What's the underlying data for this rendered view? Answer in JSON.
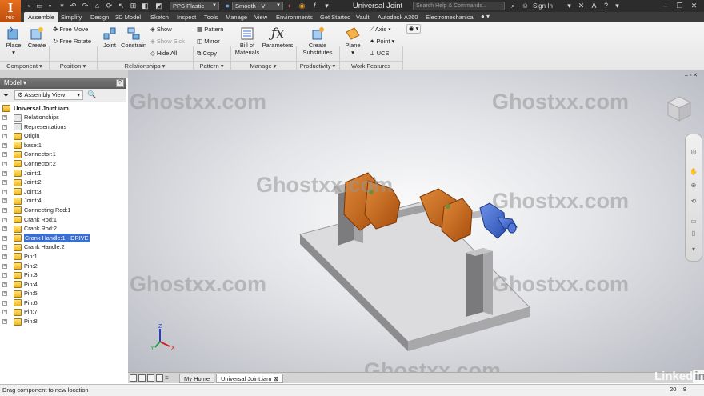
{
  "app": {
    "logo_letter": "I",
    "logo_sub": "PRO",
    "window_title": "Universal Joint"
  },
  "quick_access": {
    "material": "PPS Plastic",
    "appearance": "Smooth - V",
    "search_placeholder": "Search Help & Commands...",
    "sign_in": "Sign In"
  },
  "tabs": [
    "Assemble",
    "Simplify",
    "Design",
    "3D Model",
    "Sketch",
    "Inspect",
    "Tools",
    "Manage",
    "View",
    "Environments",
    "Get Started",
    "Vault",
    "Autodesk A360",
    "Electromechanical"
  ],
  "active_tab": "Assemble",
  "ribbon": {
    "component": {
      "label": "Component",
      "place": "Place",
      "create": "Create"
    },
    "position": {
      "label": "Position",
      "free_move": "Free Move",
      "free_rotate": "Free Rotate"
    },
    "relationships": {
      "label": "Relationships",
      "joint": "Joint",
      "constrain": "Constrain",
      "show": "Show",
      "show_sick": "Show Sick",
      "hide_all": "Hide All"
    },
    "pattern": {
      "label": "Pattern",
      "pattern": "Pattern",
      "mirror": "Mirror",
      "copy": "Copy"
    },
    "manage": {
      "label": "Manage",
      "bom_1": "Bill of",
      "bom_2": "Materials",
      "parameters": "Parameters"
    },
    "productivity": {
      "label": "Productivity",
      "create_1": "Create",
      "create_2": "Substitutes"
    },
    "work_features": {
      "label": "Work Features",
      "plane": "Plane",
      "axis": "Axis",
      "point": "Point",
      "ucs": "UCS"
    }
  },
  "model_panel": {
    "title": "Model",
    "help": "?",
    "view_mode": "Assembly View",
    "root": "Universal Joint.iam",
    "items": [
      "Relationships",
      "Representations",
      "Origin",
      "base:1",
      "Connector:1",
      "Connector:2",
      "Joint:1",
      "Joint:2",
      "Joint:3",
      "Joint:4",
      "Connecting Rod:1",
      "Crank Rod:1",
      "Crank Rod:2",
      "Crank Handle:1 - DRIVE",
      "Crank Handle:2",
      "Pin:1",
      "Pin:2",
      "Pin:3",
      "Pin:4",
      "Pin:5",
      "Pin:6",
      "Pin:7",
      "Pin:8"
    ],
    "selected": "Crank Handle:1 - DRIVE"
  },
  "watermark": "Ghostxx.com",
  "axes": {
    "x": "X",
    "y": "Y",
    "z": "Z"
  },
  "document_tabs": [
    "My Home",
    "Universal Joint.iam"
  ],
  "status": {
    "message": "Drag component to new location",
    "num1": "20",
    "num2": "8"
  },
  "brand": {
    "text": "Linked",
    "in": "in"
  },
  "colors": {
    "accent": "#e7711b",
    "selection": "#3a6fd0",
    "part_orange": "#c8661a",
    "part_blue": "#3a63c8"
  }
}
